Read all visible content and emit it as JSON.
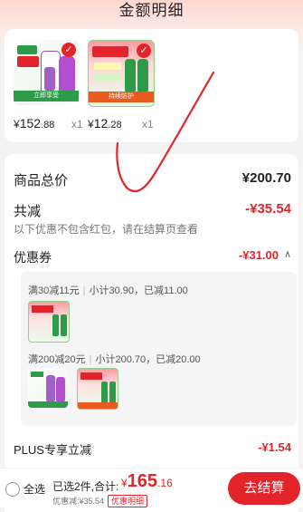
{
  "header": {
    "title": "金额明细"
  },
  "products": [
    {
      "price_symbol": "¥",
      "price_int": "152",
      "price_dec": ".88",
      "qty": "x1",
      "tag": "立即享受"
    },
    {
      "price_symbol": "¥",
      "price_int": "12",
      "price_dec": ".28",
      "qty": "x1",
      "tag": "持续防护"
    }
  ],
  "summary": {
    "total_label": "商品总价",
    "total_value": "¥200.70",
    "discount_label": "共减",
    "discount_value": "-¥35.54",
    "discount_note": "以下优惠不包含红包，请在结算页查看",
    "coupon_label": "优惠券",
    "coupon_value": "-¥31.00",
    "plus_label": "PLUS专享立减",
    "plus_value": "-¥1.54"
  },
  "coupon_groups": [
    {
      "rule": "满30减11元",
      "subtotal": "小计30.90",
      "reduced": "已减11.00"
    },
    {
      "rule": "满200减20元",
      "subtotal": "小计200.70",
      "reduced": "已减20.00"
    }
  ],
  "footer": {
    "select_all": "全选",
    "selected_text": "已选2件,合计:",
    "total_symbol": "¥",
    "total_int": "165",
    "total_dec": ".16",
    "saved_text": "优惠减:¥35.54",
    "detail_label": "优惠明细",
    "checkout_label": "去结算"
  },
  "colors": {
    "accent": "#e3242b",
    "product_green": "#2d9b48"
  }
}
